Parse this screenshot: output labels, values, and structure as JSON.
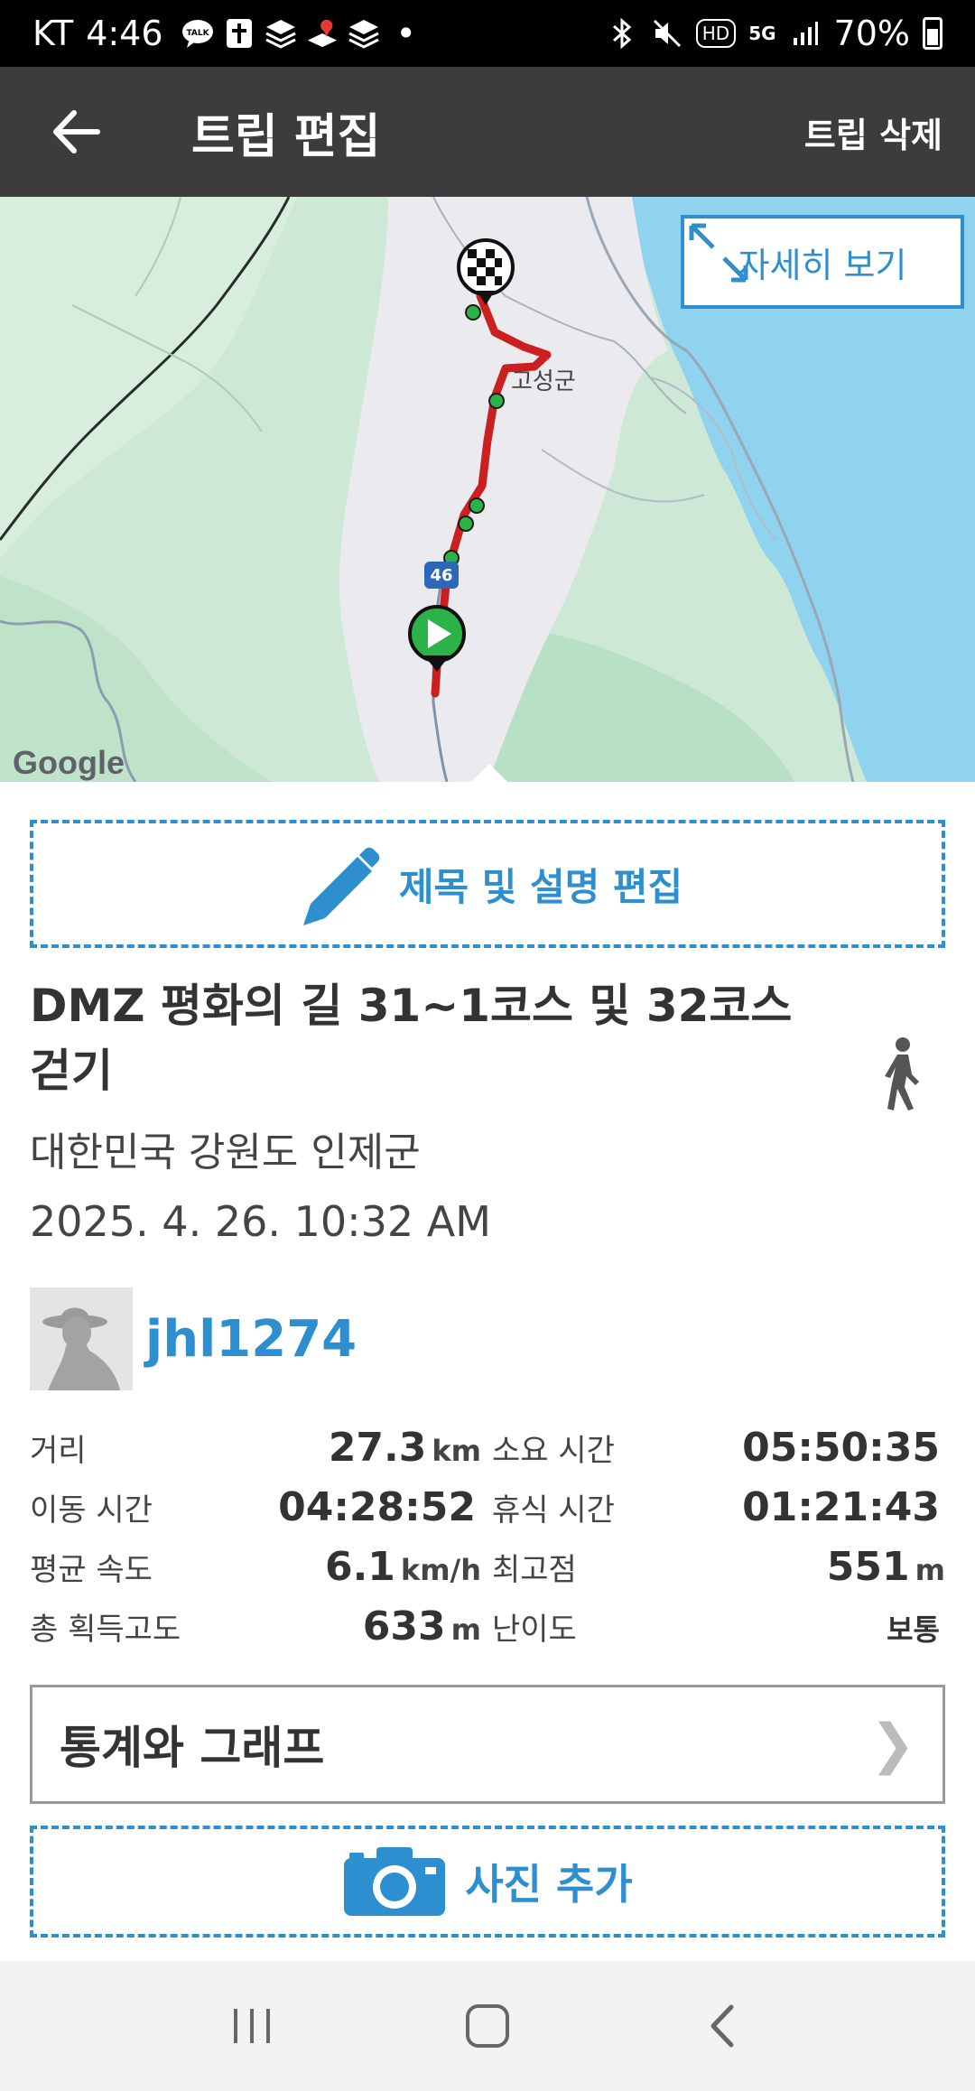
{
  "status_bar": {
    "carrier": "KT",
    "time": "4:46",
    "talk_icon_text": "TALK",
    "dot": "•",
    "hd": "HD",
    "network": "5G",
    "battery": "70%"
  },
  "app_bar": {
    "title": "트립 편집",
    "delete_label": "트립 삭제"
  },
  "map": {
    "detail_label": "자세히 보기",
    "city_label": "고성군",
    "road_number": "46",
    "google_label": "Google"
  },
  "edit_title_label": "제목 및 설명 편집",
  "trip": {
    "title": "DMZ 평화의 길 31~1코스 및 32코스 걷기",
    "location": "대한민국 강원도 인제군",
    "datetime": "2025. 4. 26. 10:32 AM",
    "username": "jhl1274"
  },
  "stats": [
    {
      "left_label": "거리",
      "left_value": "27.3",
      "left_unit": "km",
      "right_label": "소요 시간",
      "right_value": "05:50:35",
      "right_unit": ""
    },
    {
      "left_label": "이동 시간",
      "left_value": "04:28:52",
      "left_unit": "",
      "right_label": "휴식 시간",
      "right_value": "01:21:43",
      "right_unit": ""
    },
    {
      "left_label": "평균 속도",
      "left_value": "6.1",
      "left_unit": "km/h",
      "right_label": "최고점",
      "right_value": "551",
      "right_unit": "m"
    },
    {
      "left_label": "총 획득고도",
      "left_value": "633",
      "left_unit": "m",
      "right_label": "난이도",
      "right_value": "보통",
      "right_unit": ""
    }
  ],
  "stats_graph_label": "통계와 그래프",
  "chevron": "❯",
  "add_photo_label": "사진 추가",
  "colors": {
    "accent": "#2d8fd0",
    "app_bar": "#3c3c3c",
    "route": "#cc1f1f"
  }
}
